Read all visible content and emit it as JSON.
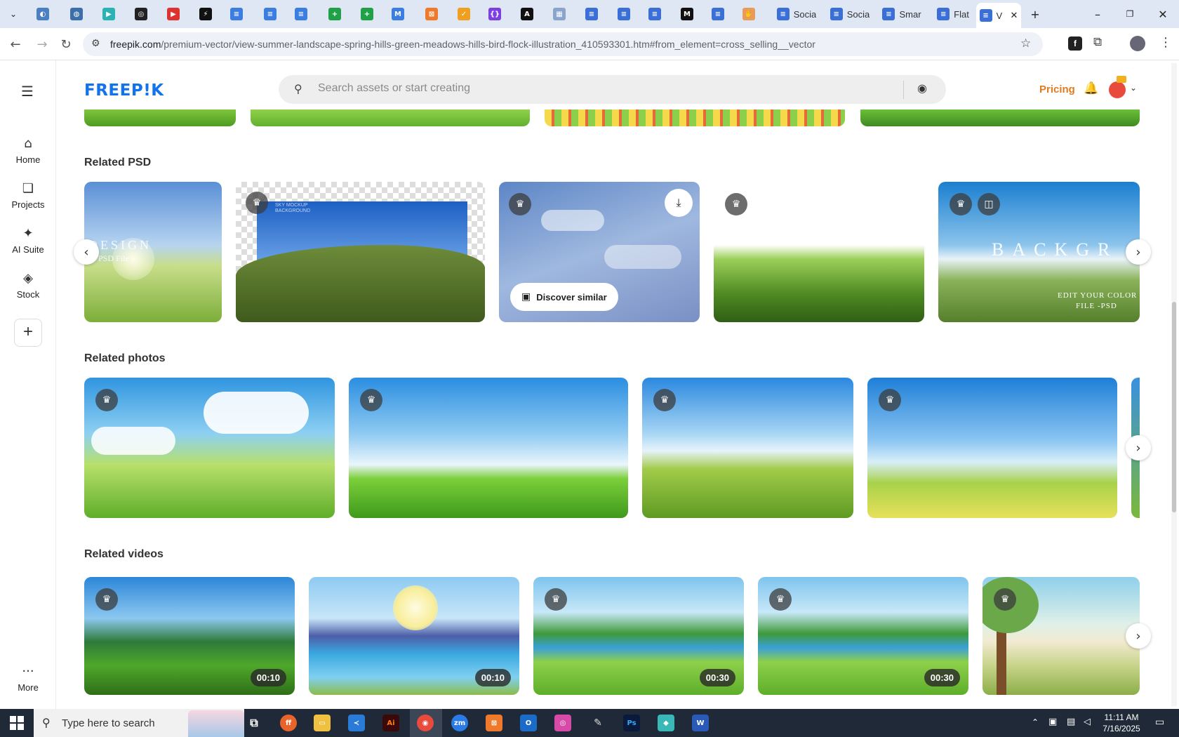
{
  "browser": {
    "tabs": [
      {
        "title": "",
        "color": "#4a7fc1"
      },
      {
        "title": "",
        "color": "#3c6fa8"
      },
      {
        "title": "",
        "color": "#2bb3b3"
      },
      {
        "title": "",
        "color": "#222222"
      },
      {
        "title": "",
        "color": "#e03131"
      },
      {
        "title": "",
        "color": "#111111"
      },
      {
        "title": "",
        "color": "#3b7de0"
      },
      {
        "title": "",
        "color": "#3b7de0"
      },
      {
        "title": "",
        "color": "#3b7de0"
      },
      {
        "title": "",
        "color": "#20a047"
      },
      {
        "title": "",
        "color": "#20a047"
      },
      {
        "title": "",
        "color": "#3b7de0"
      },
      {
        "title": "",
        "color": "#f07a2b"
      },
      {
        "title": "",
        "color": "#f0a020"
      },
      {
        "title": "",
        "color": "#7b3fe4"
      },
      {
        "title": "",
        "color": "#111111"
      },
      {
        "title": "",
        "color": "#8aa4cc"
      },
      {
        "title": "",
        "color": "#3b6fd8"
      },
      {
        "title": "",
        "color": "#3b6fd8"
      },
      {
        "title": "",
        "color": "#3b6fd8"
      },
      {
        "title": "",
        "color": "#111111"
      },
      {
        "title": "",
        "color": "#3b6fd8"
      },
      {
        "title": "",
        "color": "#e89b5a"
      }
    ],
    "named_tabs": [
      {
        "title": "Socia"
      },
      {
        "title": "Socia"
      },
      {
        "title": "Smar"
      },
      {
        "title": "Flat"
      },
      {
        "title": "V"
      }
    ],
    "url_host": "freepik.com",
    "url_path": "/premium-vector/view-summer-landscape-spring-hills-green-meadows-hills-bird-flock-illustration_410593301.htm#from_element=cross_selling__vector"
  },
  "sidebar": {
    "items": [
      {
        "label": "Home",
        "icon": "home-icon"
      },
      {
        "label": "Projects",
        "icon": "projects-icon"
      },
      {
        "label": "AI Suite",
        "icon": "ai-sparkle-icon"
      },
      {
        "label": "Stock",
        "icon": "stock-icon"
      }
    ],
    "more_label": "More"
  },
  "header": {
    "logo": "FREEP!K",
    "search_placeholder": "Search assets or start creating",
    "pricing": "Pricing"
  },
  "sections": {
    "psd": {
      "title": "Related PSD",
      "discover_label": "Discover similar"
    },
    "photos": {
      "title": "Related photos"
    },
    "videos": {
      "title": "Related videos",
      "durations": [
        "00:10",
        "00:10",
        "00:30",
        "00:30"
      ]
    }
  },
  "psd_overlay_text": {
    "card1_line1": "DESIGN",
    "card1_line2": "PSD File",
    "card2_line1": "SKY MOCKUP",
    "card2_line2": "BACKGROUND",
    "card5_line1": "BACKGR",
    "card5_line2": "EDIT YOUR COLOR",
    "card5_line3": "FILE -PSD"
  },
  "taskbar": {
    "search_placeholder": "Type here to search",
    "time": "11:11 AM",
    "date": "7/16/2025"
  },
  "colors": {
    "accent": "#1273eb",
    "pricing": "#e07b1f"
  }
}
